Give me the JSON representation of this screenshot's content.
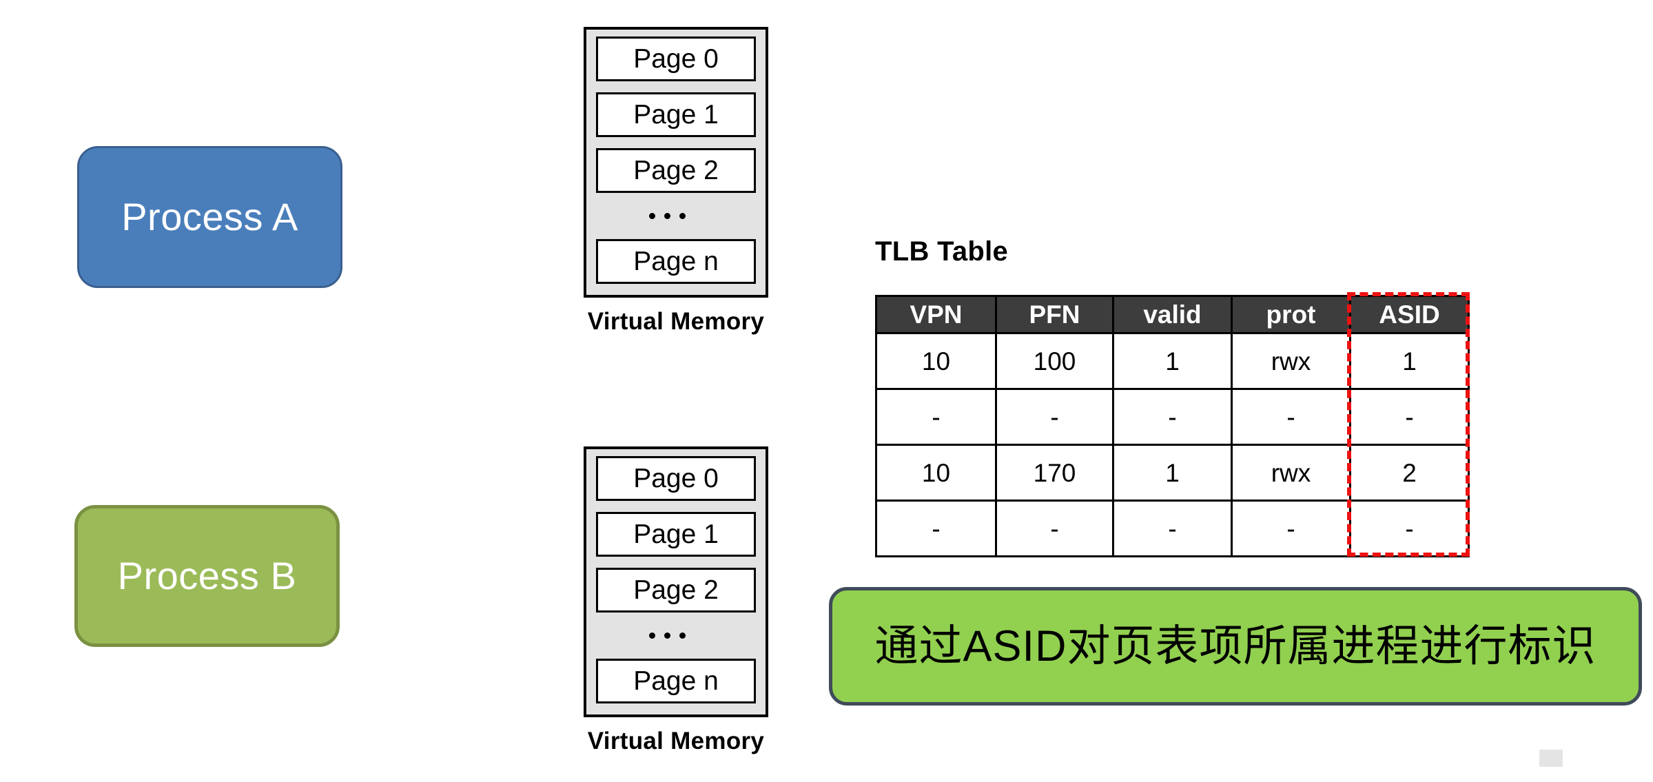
{
  "processes": [
    {
      "id": "a",
      "label": "Process A",
      "color": "#4A7EBB",
      "border_color": "#3A5F8F"
    },
    {
      "id": "b",
      "label": "Process B",
      "color": "#9BBB59",
      "border_color": "#7B9142"
    }
  ],
  "virtual_memory": {
    "caption": "Virtual Memory",
    "ellipsis": "...",
    "stacks": [
      {
        "owner": "Process A",
        "pages": [
          "Page 0",
          "Page 1",
          "Page 2",
          "Page n"
        ],
        "caption": "Virtual Memory"
      },
      {
        "owner": "Process B",
        "pages": [
          "Page 0",
          "Page 1",
          "Page 2",
          "Page n"
        ],
        "caption": "Virtual Memory"
      }
    ]
  },
  "tlb": {
    "title": "TLB Table",
    "header_bg": "#3D3D3D",
    "highlight_color": "#EE1111",
    "highlighted_column": "ASID",
    "columns": [
      "VPN",
      "PFN",
      "valid",
      "prot",
      "ASID"
    ],
    "rows": [
      {
        "VPN": "10",
        "PFN": "100",
        "valid": "1",
        "prot": "rwx",
        "ASID": "1"
      },
      {
        "VPN": "-",
        "PFN": "-",
        "valid": "-",
        "prot": "-",
        "ASID": "-"
      },
      {
        "VPN": "10",
        "PFN": "170",
        "valid": "1",
        "prot": "rwx",
        "ASID": "2"
      },
      {
        "VPN": "-",
        "PFN": "-",
        "valid": "-",
        "prot": "-",
        "ASID": "-"
      }
    ]
  },
  "caption_banner": {
    "text": "通过ASID对页表项所属进程进行标识",
    "bg_color": "#92D050",
    "border_color": "#404B5A"
  }
}
